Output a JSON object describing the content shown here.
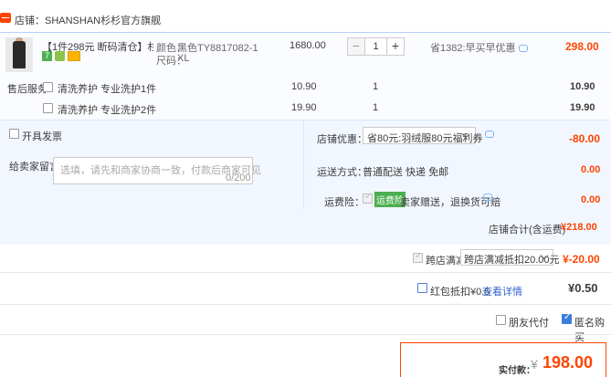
{
  "shop": {
    "label": "店铺：SHANSHAN杉杉官方旗舰"
  },
  "item": {
    "title": "【1件298元 断码清仓】杉杉男...",
    "badges": [
      "7",
      "",
      ""
    ],
    "color_label": "颜色：",
    "color_value": "黑色TY8817082-1",
    "size_label": "尺码：",
    "size_value": "XL",
    "unit_price": "1680.00",
    "qty": "1",
    "qty_minus": "−",
    "qty_plus": "+",
    "saving": "省1382:早买早优惠",
    "total": "298.00"
  },
  "services": {
    "label": "售后服务",
    "rows": [
      {
        "name": "清洗养护 专业洗护1件",
        "price": "10.90",
        "qty": "1",
        "total": "10.90"
      },
      {
        "name": "清洗养护 专业洗护2件",
        "price": "19.90",
        "qty": "1",
        "total": "19.90"
      }
    ]
  },
  "invoice": {
    "label": "开具发票"
  },
  "message": {
    "label": "给卖家留言：",
    "placeholder": "选填，请先和商家协商一致，付款后商家可见",
    "counter": "0/200"
  },
  "shop_discount": {
    "label": "店铺优惠：",
    "selected": "省80元:羽绒服80元福利券",
    "amount": "-80.00"
  },
  "shipping": {
    "label": "运送方式：",
    "value": "普通配送 快递 免邮",
    "amount": "0.00"
  },
  "insurance": {
    "label": "运费险：",
    "badge": "运费险",
    "text": "卖家赠送，退换货可赔",
    "amount": "0.00"
  },
  "subtotal": {
    "label": "店铺合计(含运费)",
    "value": "¥218.00"
  },
  "cross_store": {
    "label": "跨店满减",
    "selected": "跨店满减抵扣20.00元",
    "amount": "¥-20.00"
  },
  "red_packet": {
    "label": "红包抵扣¥0.5",
    "link": "查看详情",
    "amount": "¥0.50"
  },
  "options": {
    "friend_pay": "朋友代付",
    "anonymous": "匿名购买"
  },
  "payment": {
    "label": "实付款：",
    "currency": "¥",
    "value": "198.00"
  },
  "colors": {
    "accent": "#ff4400",
    "link": "#3366cc",
    "panel": "#f2f7ff"
  }
}
